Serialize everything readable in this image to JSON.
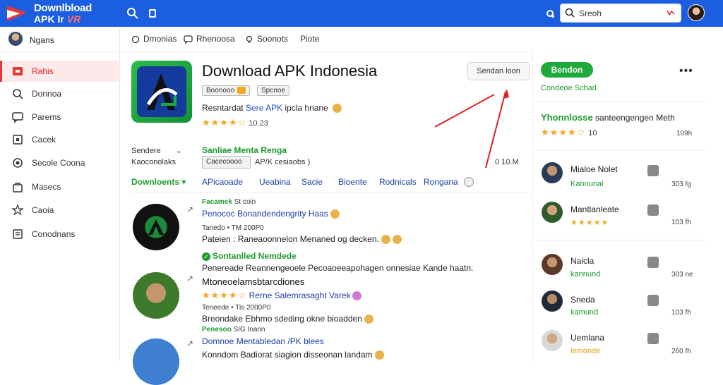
{
  "topbar": {
    "logo_line1": "Downlbload",
    "logo_line2": "APK Ir",
    "logo_accent": "VR",
    "search_placeholder": "Sreoh",
    "icons": [
      "search-icon",
      "menu-icon",
      "refresh-icon",
      "user-avatar"
    ]
  },
  "sidebar": {
    "user_name": "Ngans",
    "items": [
      {
        "label": "Rahis",
        "icon": "home-icon",
        "active": true
      },
      {
        "label": "Donnoa",
        "icon": "search-icon",
        "active": false
      },
      {
        "label": "Parems",
        "icon": "chat-icon",
        "active": false
      },
      {
        "label": "Cacek",
        "icon": "box-icon",
        "active": false
      },
      {
        "label": "Secole Coona",
        "icon": "target-icon",
        "active": false
      },
      {
        "label": "Masecs",
        "icon": "bag-icon",
        "active": false
      },
      {
        "label": "Caoia",
        "icon": "star-icon",
        "active": false
      },
      {
        "label": "Conodnans",
        "icon": "list-icon",
        "active": false
      }
    ]
  },
  "subnav": {
    "items": [
      {
        "label": "Dmonias",
        "icon": "compass-icon"
      },
      {
        "label": "Rhenoosa",
        "icon": "comment-icon"
      },
      {
        "label": "Soonots",
        "icon": "bulb-icon"
      },
      {
        "label": "Piote",
        "icon": ""
      }
    ]
  },
  "app": {
    "title": "Download APK Indonesia",
    "secondary_button": "Sendan loon",
    "tags": [
      "Boonooo",
      "Spcnoe"
    ],
    "desc_prefix": "Resntardat",
    "desc_blue": "Sere APK",
    "desc_suffix": "ipcla hnane",
    "rating_stars": "★★★★☆",
    "rating_value": "10.23",
    "info_key1": "Sendere",
    "info_key2": "Kaoconolaks",
    "info_value_green": "Sanliae Menta Renga",
    "file_box": "Cacecoooo",
    "file_info": "AP/K cesiaobs )",
    "file_size": "0 10.M",
    "download_tab": "Downloents",
    "tabs": [
      "APicaoade",
      "Ueabina",
      "Sacie",
      "Bioente",
      "Rodnicals",
      "Rongana"
    ]
  },
  "feed": {
    "post1": {
      "cat": "Facamek",
      "cat_suffix": "St coin",
      "title": "Penococ Bonandendengrity Haas",
      "meta": "Tanedo • TM 200P0",
      "body": "Pateien : Raneaoonnelon Menaned og decken."
    },
    "post2": {
      "verified": "Sontanlled Nemdede",
      "body_top": "Penereade Reannengeoele Pecoaoeeapohagen onnesiae Kande haatn.",
      "title": "Mtoneoelamsbtarcdiones",
      "stars": "★★★★☆",
      "title2": "Rerne Salemrasaght Varek",
      "meta": "Teneede • Tis 2000P0",
      "body": "Breondake Ebhmo sdeding okne bioadden"
    },
    "post3": {
      "cat": "Penesoo",
      "cat_suffix": "SIG Inann",
      "title": "Domnoe Mentabledan /PK blees",
      "body": "Konndom Badiorat siagion disseonan landam"
    }
  },
  "right": {
    "green_button": "Bendon",
    "link": "Condeoe Schad",
    "featured_green": "Yhonnlosse",
    "featured_text": "santeengengen Meth",
    "featured_stars": "★★★★☆",
    "featured_count": "10",
    "featured_size": "109h",
    "people": [
      {
        "name": "Mialoe Nolet",
        "sub": "Kannunal",
        "size": "303 fg",
        "sub_color": "#1e9b2e"
      },
      {
        "name": "Mantlanleate",
        "sub": "★★★★★",
        "size": "103 fh",
        "sub_color": "#f5a623"
      },
      {
        "name": "Naicla",
        "sub": "kannund",
        "size": "303 ne",
        "sub_color": "#1e9b2e"
      },
      {
        "name": "Sneda",
        "sub": "kamund",
        "size": "103 fh",
        "sub_color": "#1e9b2e"
      },
      {
        "name": "Uemlana",
        "sub": "lemonde",
        "size": "260 fh",
        "sub_color": "#e0a010"
      }
    ]
  },
  "colors": {
    "brand_blue": "#1b5fe0",
    "accent_green": "#1ea93b",
    "active_red": "#e53935",
    "star_gold": "#f5a623"
  }
}
